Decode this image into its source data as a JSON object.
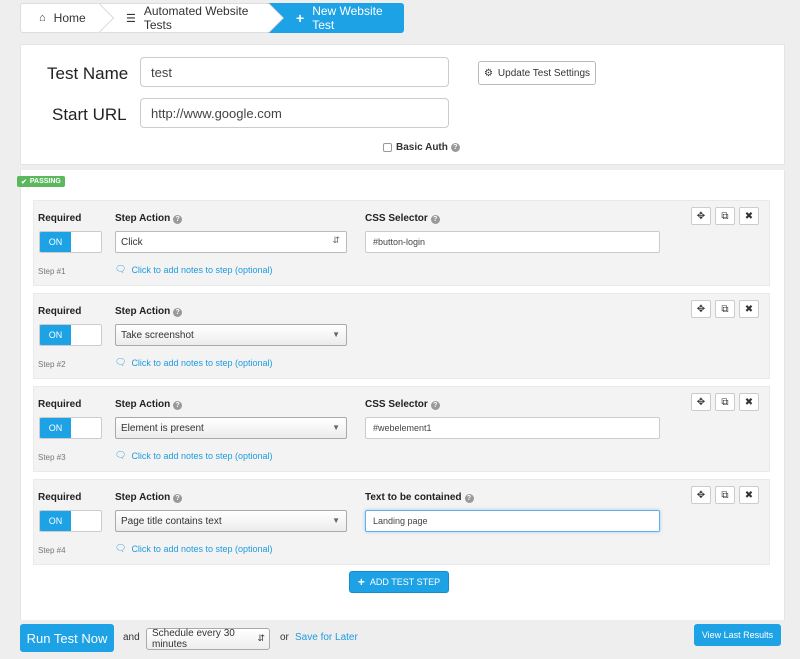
{
  "breadcrumb": {
    "home": "Home",
    "automated": "Automated Website Tests",
    "new": "New Website Test"
  },
  "settings": {
    "test_name_label": "Test Name",
    "test_name_value": "test",
    "start_url_label": "Start URL",
    "start_url_value": "http://www.google.com",
    "update_button": "Update Test Settings",
    "basic_auth": "Basic Auth"
  },
  "status_badge": "PASSING",
  "steps": [
    {
      "required": "Required",
      "toggle": "ON",
      "step_num": "Step #1",
      "action_label": "Step Action",
      "action": "Click",
      "field_label": "CSS Selector",
      "field_value": "#button-login",
      "notes": "Click to add notes to step (optional)"
    },
    {
      "required": "Required",
      "toggle": "ON",
      "step_num": "Step #2",
      "action_label": "Step Action",
      "action": "Take screenshot",
      "notes": "Click to add notes to step (optional)"
    },
    {
      "required": "Required",
      "toggle": "ON",
      "step_num": "Step #3",
      "action_label": "Step Action",
      "action": "Element is present",
      "field_label": "CSS Selector",
      "field_value": "#webelement1",
      "notes": "Click to add notes to step (optional)"
    },
    {
      "required": "Required",
      "toggle": "ON",
      "step_num": "Step #4",
      "action_label": "Step Action",
      "action": "Page title contains text",
      "field_label": "Text to be contained",
      "field_value": "Landing page",
      "notes": "Click to add notes to step (optional)"
    }
  ],
  "add_step": "ADD TEST STEP",
  "footer": {
    "run": "Run Test Now",
    "and": "and",
    "schedule": "Schedule every 30 minutes",
    "or": "or",
    "save": "Save for Later",
    "view": "View Last Results"
  },
  "colors": {
    "accent": "#1ea2e6",
    "passing": "#5cb85c"
  }
}
